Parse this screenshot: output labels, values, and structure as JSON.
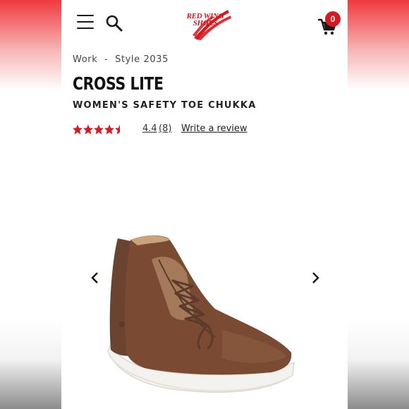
{
  "header": {
    "logo_text": [
      "RED WING",
      "SHOES"
    ],
    "cart_count": "0",
    "menu_icon": "hamburger-menu-icon",
    "search_icon": "search-icon",
    "cart_icon": "cart-icon"
  },
  "breadcrumb": {
    "category": "Work",
    "separator": "-",
    "style": "Style 2035"
  },
  "product": {
    "name": "CROSS LITE",
    "subtitle": "WOMEN'S SAFETY TOE CHUKKA",
    "rating": 4.4,
    "rating_label": "4.4",
    "review_count": "(8)",
    "write_review": "Write a review"
  },
  "gallery": {
    "prev_icon": "chevron-left-icon",
    "next_icon": "chevron-right-icon"
  },
  "colors": {
    "brand_red": "#d71920",
    "text_dark": "#111111",
    "boot_leather": "#7a4a33",
    "sole": "#f4f2ee"
  }
}
